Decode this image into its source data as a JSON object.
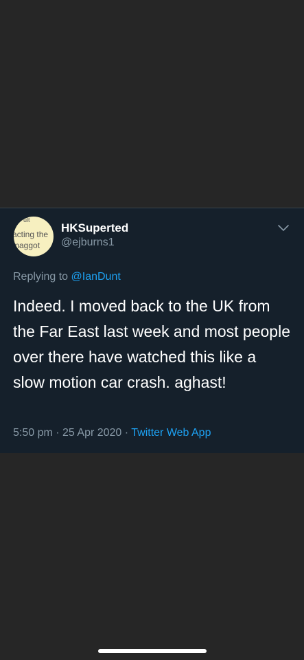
{
  "tweet": {
    "avatar_text": [
      "ult",
      "acting the",
      "maggot"
    ],
    "display_name": "HKSuperted",
    "handle": "@ejburns1",
    "replying_prefix": "Replying to",
    "replying_to": "@IanDunt",
    "body": "Indeed. I moved back to the UK from the Far East last week and most people over there have watched this like a slow motion car crash. aghast!",
    "time": "5:50 pm",
    "separator": " · ",
    "date": "25 Apr 2020",
    "source": "Twitter Web App"
  },
  "icons": {
    "menu": "chevron-down-icon"
  },
  "colors": {
    "tweet_background": "#15202b",
    "page_background": "#262626",
    "accent": "#1da1f2",
    "secondary_text": "#8899a6",
    "primary_text": "#ffffff"
  }
}
